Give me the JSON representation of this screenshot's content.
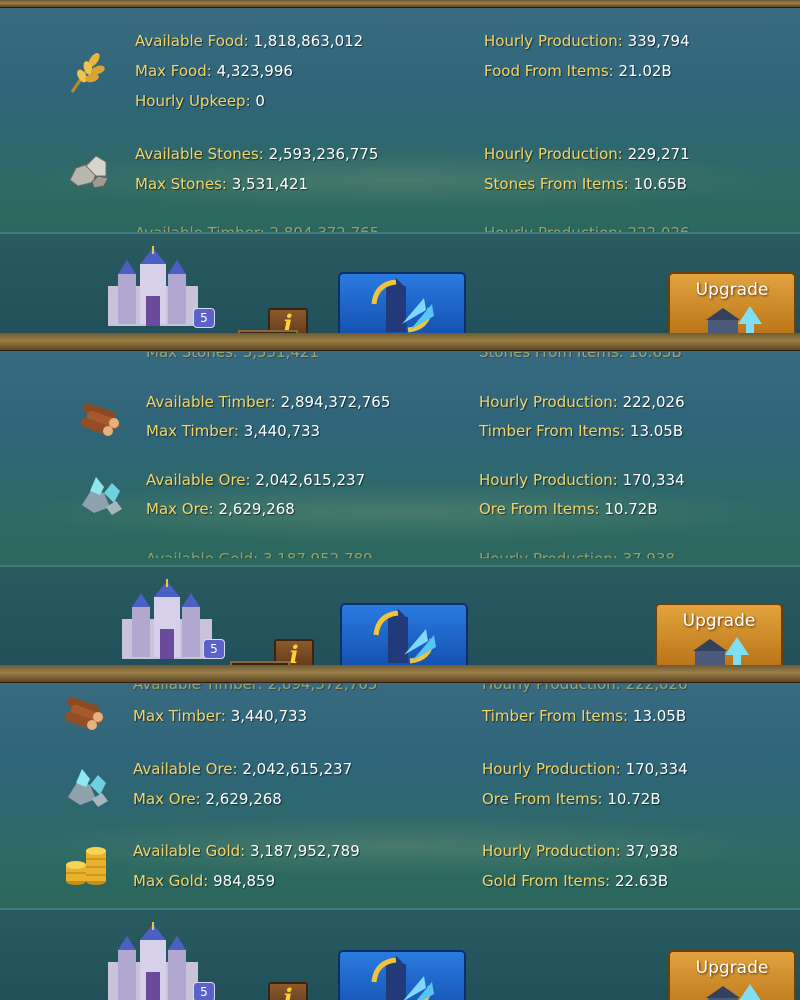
{
  "panels": [
    {
      "resources": [
        {
          "icon": "wheat-icon",
          "lines": [
            {
              "label": "Available Food:",
              "value": "1,818,863,012"
            },
            {
              "label": "Max Food:",
              "value": "4,323,996"
            },
            {
              "label": "Hourly Upkeep:",
              "value": "0"
            }
          ],
          "right": [
            {
              "label": "Hourly Production:",
              "value": "339,794"
            },
            {
              "label": "Food From Items:",
              "value": "21.02B"
            }
          ]
        },
        {
          "icon": "stones-icon",
          "lines": [
            {
              "label": "Available Stones:",
              "value": "2,593,236,775"
            },
            {
              "label": "Max Stones:",
              "value": "3,531,421"
            }
          ],
          "right": [
            {
              "label": "Hourly Production:",
              "value": "229,271"
            },
            {
              "label": "Stones From Items:",
              "value": "10.65B"
            }
          ]
        }
      ],
      "cutoff": {
        "left": "Available Timber: 2,894,372,765",
        "right": "Hourly Production: 222,026"
      }
    },
    {
      "cut_top": {
        "left": "Max Stones: 3,531,421",
        "right": "Stones From Items: 10.65B"
      },
      "resources": [
        {
          "icon": "timber-icon",
          "lines": [
            {
              "label": "Available Timber:",
              "value": "2,894,372,765"
            },
            {
              "label": "Max Timber:",
              "value": "3,440,733"
            }
          ],
          "right": [
            {
              "label": "Hourly Production:",
              "value": "222,026"
            },
            {
              "label": "Timber From Items:",
              "value": "13.05B"
            }
          ]
        },
        {
          "icon": "ore-icon",
          "lines": [
            {
              "label": "Available Ore:",
              "value": "2,042,615,237"
            },
            {
              "label": "Max Ore:",
              "value": "2,629,268"
            }
          ],
          "right": [
            {
              "label": "Hourly Production:",
              "value": "170,334"
            },
            {
              "label": "Ore From Items:",
              "value": "10.72B"
            }
          ]
        }
      ],
      "cutoff": {
        "left": "Available Gold: 3,187,952,789",
        "right": "Hourly Production: 37,938"
      }
    },
    {
      "cut_top": {
        "left": "Available Timber: 2,894,372,765",
        "right": "Hourly Production: 222,026"
      },
      "resources": [
        {
          "icon": "timber-icon",
          "lines": [
            {
              "label": "Max Timber:",
              "value": "3,440,733"
            }
          ],
          "right": [
            {
              "label": "Timber From Items:",
              "value": "13.05B"
            }
          ]
        },
        {
          "icon": "ore-icon",
          "lines": [
            {
              "label": "Available Ore:",
              "value": "2,042,615,237"
            },
            {
              "label": "Max Ore:",
              "value": "2,629,268"
            }
          ],
          "right": [
            {
              "label": "Hourly Production:",
              "value": "170,334"
            },
            {
              "label": "Ore From Items:",
              "value": "10.72B"
            }
          ]
        },
        {
          "icon": "gold-icon",
          "lines": [
            {
              "label": "Available Gold:",
              "value": "3,187,952,789"
            },
            {
              "label": "Max Gold:",
              "value": "984,859"
            }
          ],
          "right": [
            {
              "label": "Hourly Production:",
              "value": "37,938"
            },
            {
              "label": "Gold From Items:",
              "value": "22.63B"
            }
          ]
        }
      ]
    }
  ],
  "castle_level": "5",
  "info_label": "i",
  "upgrade_label": "Upgrade"
}
